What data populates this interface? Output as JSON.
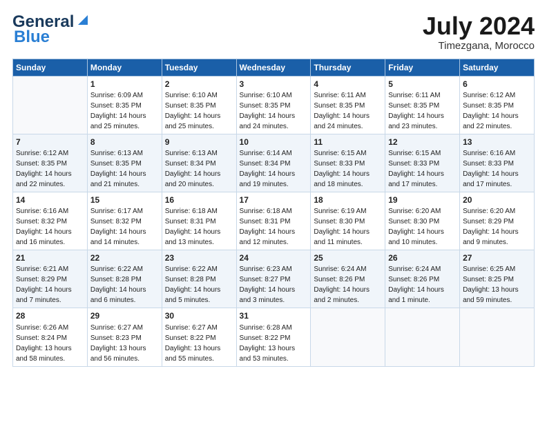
{
  "header": {
    "logo_line1": "General",
    "logo_line2": "Blue",
    "month_title": "July 2024",
    "location": "Timezgana, Morocco"
  },
  "weekdays": [
    "Sunday",
    "Monday",
    "Tuesday",
    "Wednesday",
    "Thursday",
    "Friday",
    "Saturday"
  ],
  "weeks": [
    [
      {
        "num": "",
        "empty": true
      },
      {
        "num": "1",
        "sunrise": "6:09 AM",
        "sunset": "8:35 PM",
        "daylight": "14 hours and 25 minutes."
      },
      {
        "num": "2",
        "sunrise": "6:10 AM",
        "sunset": "8:35 PM",
        "daylight": "14 hours and 25 minutes."
      },
      {
        "num": "3",
        "sunrise": "6:10 AM",
        "sunset": "8:35 PM",
        "daylight": "14 hours and 24 minutes."
      },
      {
        "num": "4",
        "sunrise": "6:11 AM",
        "sunset": "8:35 PM",
        "daylight": "14 hours and 24 minutes."
      },
      {
        "num": "5",
        "sunrise": "6:11 AM",
        "sunset": "8:35 PM",
        "daylight": "14 hours and 23 minutes."
      },
      {
        "num": "6",
        "sunrise": "6:12 AM",
        "sunset": "8:35 PM",
        "daylight": "14 hours and 22 minutes."
      }
    ],
    [
      {
        "num": "7",
        "sunrise": "6:12 AM",
        "sunset": "8:35 PM",
        "daylight": "14 hours and 22 minutes."
      },
      {
        "num": "8",
        "sunrise": "6:13 AM",
        "sunset": "8:35 PM",
        "daylight": "14 hours and 21 minutes."
      },
      {
        "num": "9",
        "sunrise": "6:13 AM",
        "sunset": "8:34 PM",
        "daylight": "14 hours and 20 minutes."
      },
      {
        "num": "10",
        "sunrise": "6:14 AM",
        "sunset": "8:34 PM",
        "daylight": "14 hours and 19 minutes."
      },
      {
        "num": "11",
        "sunrise": "6:15 AM",
        "sunset": "8:33 PM",
        "daylight": "14 hours and 18 minutes."
      },
      {
        "num": "12",
        "sunrise": "6:15 AM",
        "sunset": "8:33 PM",
        "daylight": "14 hours and 17 minutes."
      },
      {
        "num": "13",
        "sunrise": "6:16 AM",
        "sunset": "8:33 PM",
        "daylight": "14 hours and 17 minutes."
      }
    ],
    [
      {
        "num": "14",
        "sunrise": "6:16 AM",
        "sunset": "8:32 PM",
        "daylight": "14 hours and 16 minutes."
      },
      {
        "num": "15",
        "sunrise": "6:17 AM",
        "sunset": "8:32 PM",
        "daylight": "14 hours and 14 minutes."
      },
      {
        "num": "16",
        "sunrise": "6:18 AM",
        "sunset": "8:31 PM",
        "daylight": "14 hours and 13 minutes."
      },
      {
        "num": "17",
        "sunrise": "6:18 AM",
        "sunset": "8:31 PM",
        "daylight": "14 hours and 12 minutes."
      },
      {
        "num": "18",
        "sunrise": "6:19 AM",
        "sunset": "8:30 PM",
        "daylight": "14 hours and 11 minutes."
      },
      {
        "num": "19",
        "sunrise": "6:20 AM",
        "sunset": "8:30 PM",
        "daylight": "14 hours and 10 minutes."
      },
      {
        "num": "20",
        "sunrise": "6:20 AM",
        "sunset": "8:29 PM",
        "daylight": "14 hours and 9 minutes."
      }
    ],
    [
      {
        "num": "21",
        "sunrise": "6:21 AM",
        "sunset": "8:29 PM",
        "daylight": "14 hours and 7 minutes."
      },
      {
        "num": "22",
        "sunrise": "6:22 AM",
        "sunset": "8:28 PM",
        "daylight": "14 hours and 6 minutes."
      },
      {
        "num": "23",
        "sunrise": "6:22 AM",
        "sunset": "8:28 PM",
        "daylight": "14 hours and 5 minutes."
      },
      {
        "num": "24",
        "sunrise": "6:23 AM",
        "sunset": "8:27 PM",
        "daylight": "14 hours and 3 minutes."
      },
      {
        "num": "25",
        "sunrise": "6:24 AM",
        "sunset": "8:26 PM",
        "daylight": "14 hours and 2 minutes."
      },
      {
        "num": "26",
        "sunrise": "6:24 AM",
        "sunset": "8:26 PM",
        "daylight": "14 hours and 1 minute."
      },
      {
        "num": "27",
        "sunrise": "6:25 AM",
        "sunset": "8:25 PM",
        "daylight": "13 hours and 59 minutes."
      }
    ],
    [
      {
        "num": "28",
        "sunrise": "6:26 AM",
        "sunset": "8:24 PM",
        "daylight": "13 hours and 58 minutes."
      },
      {
        "num": "29",
        "sunrise": "6:27 AM",
        "sunset": "8:23 PM",
        "daylight": "13 hours and 56 minutes."
      },
      {
        "num": "30",
        "sunrise": "6:27 AM",
        "sunset": "8:22 PM",
        "daylight": "13 hours and 55 minutes."
      },
      {
        "num": "31",
        "sunrise": "6:28 AM",
        "sunset": "8:22 PM",
        "daylight": "13 hours and 53 minutes."
      },
      {
        "num": "",
        "empty": true
      },
      {
        "num": "",
        "empty": true
      },
      {
        "num": "",
        "empty": true
      }
    ]
  ],
  "labels": {
    "sunrise": "Sunrise:",
    "sunset": "Sunset:",
    "daylight": "Daylight:"
  }
}
